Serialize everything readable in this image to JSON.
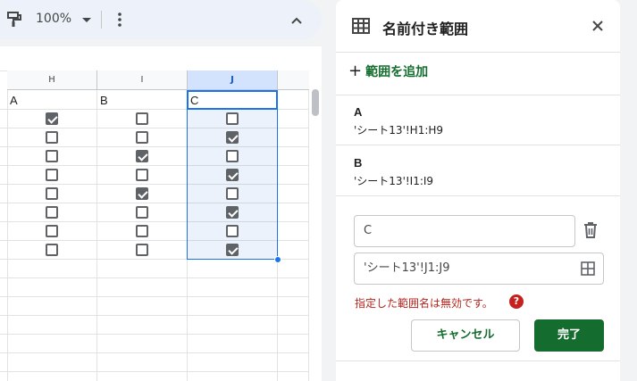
{
  "toolbar": {
    "zoom": "100%",
    "icons": [
      "paint-format-icon",
      "more-vert-icon",
      "chevron-up-icon"
    ]
  },
  "sheet": {
    "columns": [
      "H",
      "I",
      "J"
    ],
    "selected_column": "J",
    "headers": [
      "A",
      "B",
      "C"
    ],
    "checkboxes": {
      "H": [
        true,
        false,
        false,
        false,
        false,
        false,
        false,
        false
      ],
      "I": [
        false,
        false,
        true,
        false,
        true,
        false,
        false,
        false
      ],
      "J": [
        false,
        true,
        false,
        true,
        false,
        true,
        false,
        true
      ]
    }
  },
  "panel": {
    "title": "名前付き範囲",
    "add_range_label": "範囲を追加",
    "ranges": [
      {
        "name": "A",
        "ref": "'シート13'!H1:H9"
      },
      {
        "name": "B",
        "ref": "'シート13'!I1:I9"
      }
    ],
    "edit": {
      "name_value": "C",
      "ref_value": "'シート13'!J1:J9",
      "error": "指定した範囲名は無効です。",
      "error_icon": "?",
      "cancel_label": "キャンセル",
      "done_label": "完了"
    }
  },
  "colors": {
    "accent_green": "#146c2e",
    "selection_blue": "#1a73e8",
    "error_red": "#b3261e"
  }
}
